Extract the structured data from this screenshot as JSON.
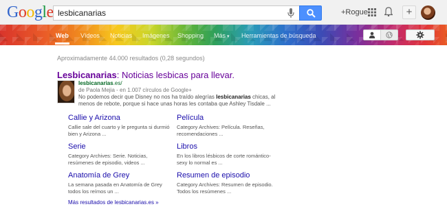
{
  "header": {
    "logo_letters": [
      "G",
      "o",
      "o",
      "g",
      "l",
      "e"
    ],
    "search_value": "lesbicanarias",
    "plus_user": "+Rogue",
    "share_symbol": "+"
  },
  "tabs": [
    {
      "label": "Web",
      "active": true
    },
    {
      "label": "Vídeos",
      "active": false
    },
    {
      "label": "Noticias",
      "active": false
    },
    {
      "label": "Imágenes",
      "active": false
    },
    {
      "label": "Shopping",
      "active": false
    },
    {
      "label": "Más",
      "active": false,
      "caret": "▾"
    },
    {
      "label": "Herramientas de búsqueda",
      "active": false
    }
  ],
  "stats": "Aproximadamente 44.000 resultados (0,28 segundos)",
  "result": {
    "title_bold": "Lesbicanarias",
    "title_rest": ": Noticias lesbicas para llevar.",
    "url_bold": "lesbicanarias",
    "url_rest": ".es/",
    "author": "de Paola Mejia - en 1.007 círculos de Google+",
    "desc_1": "No podemos decir que Disney no nos ha traído alegrías ",
    "desc_bold": "lesbicanarias",
    "desc_2": " chicas, al menos de rebote, porque si hace unas horas les contaba que Ashley Tisdale ..."
  },
  "sitelinks": [
    {
      "title": "Callie y Arizona",
      "desc": "Callie sale del cuarto y le pregunta si durmió bien y Arizona ..."
    },
    {
      "title": "Película",
      "desc": "Category Archives: Película. Reseñas, recomendaciones ..."
    },
    {
      "title": "Serie",
      "desc": "Category Archives: Serie. Noticias, resúmenes de episodio, videos ..."
    },
    {
      "title": "Libros",
      "desc": "En los libros lésbicos de corte romántico-sexy lo normal es ..."
    },
    {
      "title": "Anatomía de Grey",
      "desc": "La semana pasada en Anatomía de Grey todos los reímos un ..."
    },
    {
      "title": "Resumen de episodio",
      "desc": "Category Archives: Resumen de episodio. Todos los resúmenes ..."
    }
  ],
  "more_link": "Más resultados de lesbicanarias.es »",
  "colors": {
    "accent": "#4d90fe",
    "link": "#1a0dab",
    "visited": "#660099",
    "url": "#006621"
  }
}
